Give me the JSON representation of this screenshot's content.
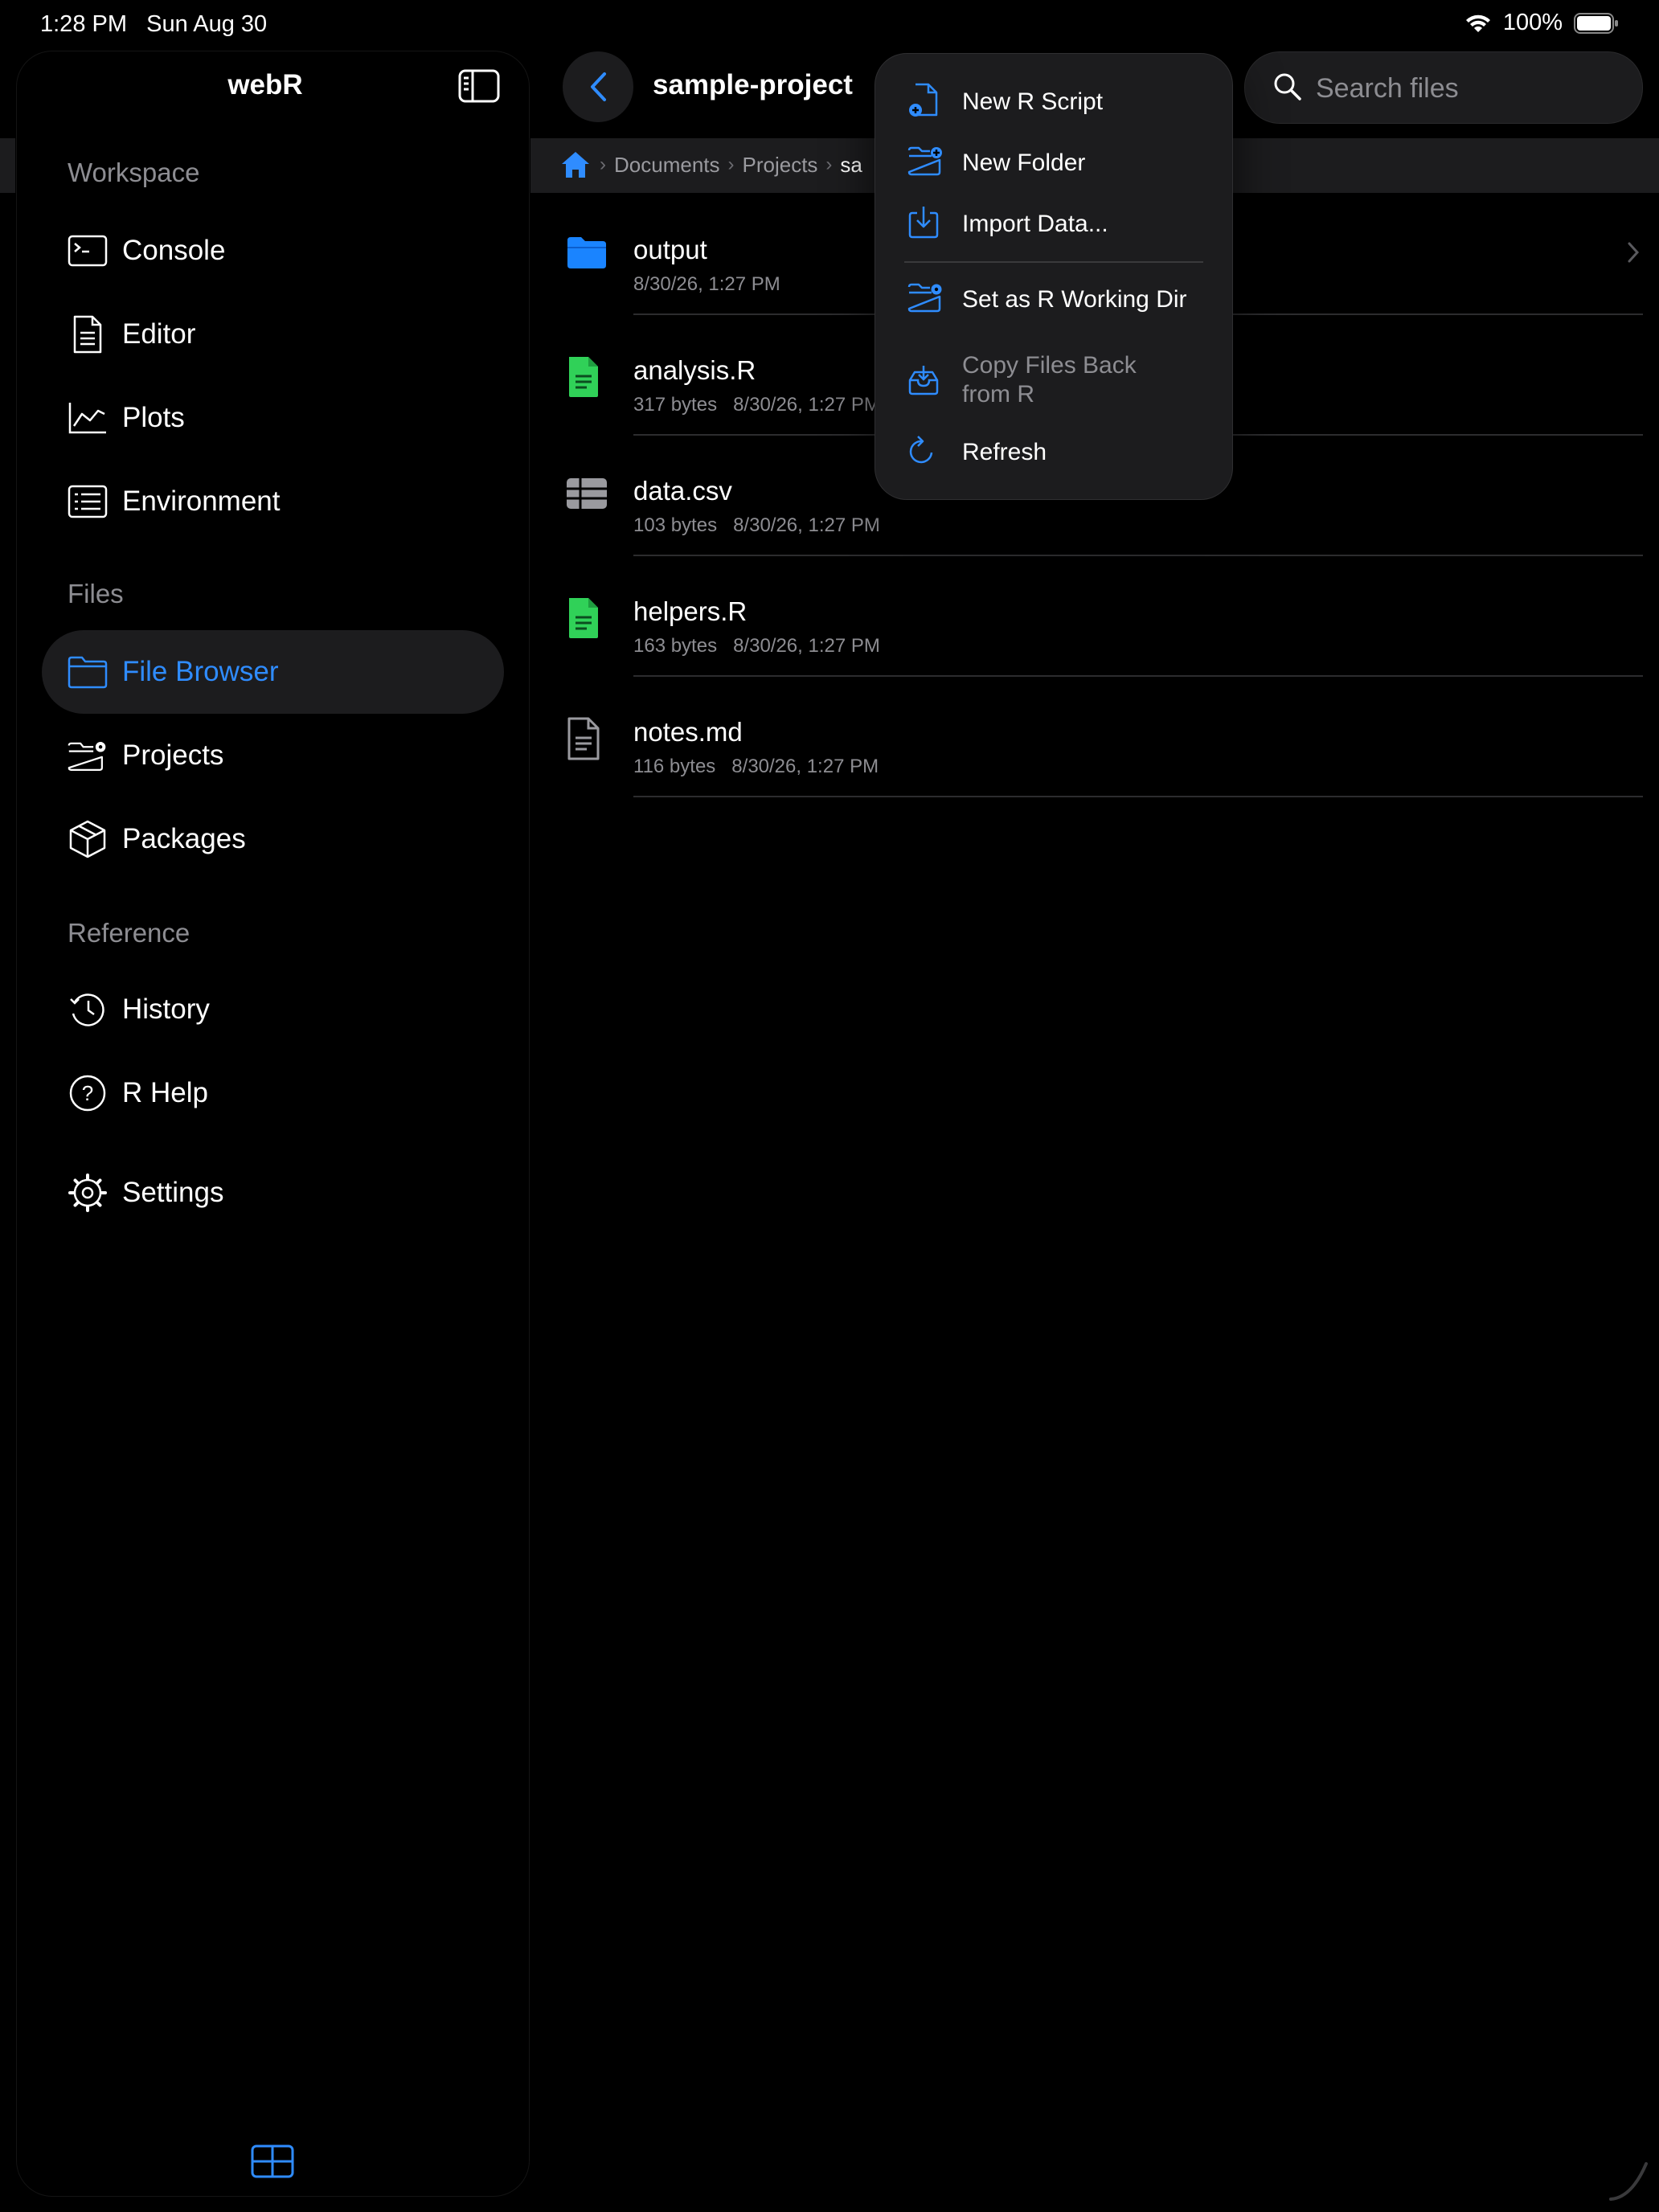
{
  "status_bar": {
    "time": "1:28 PM",
    "date": "Sun Aug 30",
    "battery": "100%"
  },
  "sidebar": {
    "title": "webR",
    "sections": {
      "workspace": "Workspace",
      "files": "Files",
      "reference": "Reference"
    },
    "items": {
      "console": "Console",
      "editor": "Editor",
      "plots": "Plots",
      "environment": "Environment",
      "file_browser": "File Browser",
      "projects": "Projects",
      "packages": "Packages",
      "history": "History",
      "r_help": "R Help",
      "settings": "Settings"
    },
    "active_item": "File Browser"
  },
  "toolbar": {
    "title": "sample-project",
    "search_placeholder": "Search files"
  },
  "breadcrumb": {
    "items": [
      "Documents",
      "Projects",
      "sa"
    ]
  },
  "files": [
    {
      "name": "output",
      "meta": "8/30/26, 1:27 PM",
      "type": "folder"
    },
    {
      "name": "analysis.R",
      "meta": "317 bytes   8/30/26, 1:27 PM",
      "type": "r-script"
    },
    {
      "name": "data.csv",
      "meta": "103 bytes   8/30/26, 1:27 PM",
      "type": "table"
    },
    {
      "name": "helpers.R",
      "meta": "163 bytes   8/30/26, 1:27 PM",
      "type": "r-script"
    },
    {
      "name": "notes.md",
      "meta": "116 bytes   8/30/26, 1:27 PM",
      "type": "document"
    }
  ],
  "menu": {
    "new_r_script": "New R Script",
    "new_folder": "New Folder",
    "import_data": "Import Data...",
    "set_working_dir": "Set as R Working Dir",
    "copy_files_back_line1": "Copy Files Back",
    "copy_files_back_line2": "from R",
    "refresh": "Refresh"
  },
  "colors": {
    "accent": "#2f8cff",
    "r_file": "#30d158",
    "background": "#000000",
    "surface": "#1c1c1e"
  }
}
